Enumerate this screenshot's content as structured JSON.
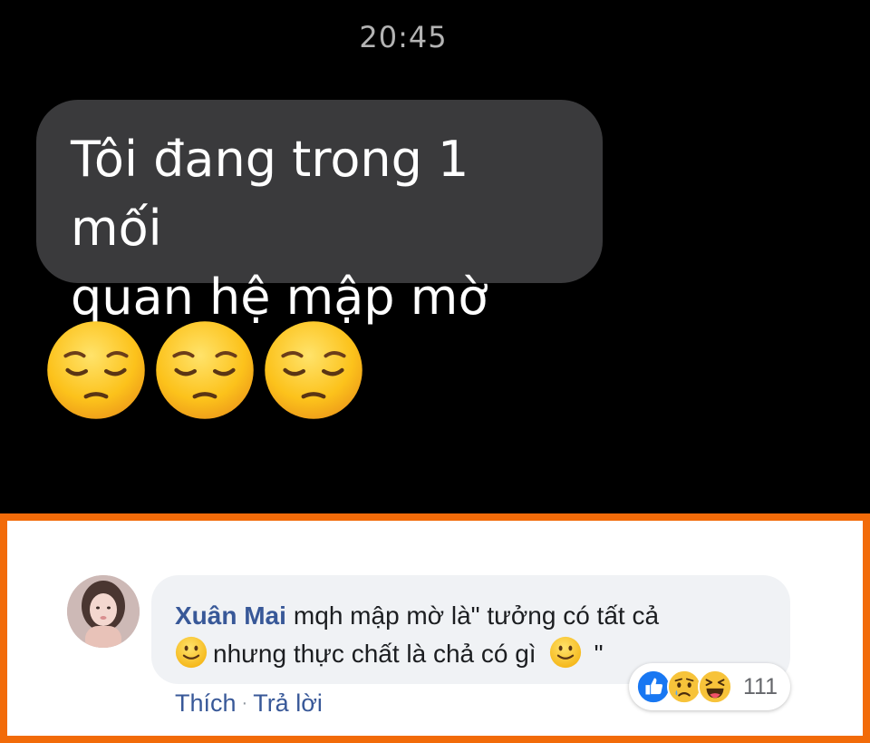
{
  "status": {
    "time": "20:45"
  },
  "message": {
    "line1": "Tôi đang trong 1 mối",
    "line2": "quan hệ mập mờ",
    "emojis": [
      "pensive-face-icon",
      "pensive-face-icon",
      "pensive-face-icon"
    ]
  },
  "comment": {
    "author": "Xuân Mai",
    "text_part1": "mqh mập mờ là\" tưởng có tất cả",
    "text_part2": "nhưng thực chất là chả có gì",
    "text_part3": "\"",
    "inline_emoji": "slightly-smiling-face-icon",
    "actions": {
      "like": "Thích",
      "separator": "·",
      "reply": "Trả lời"
    },
    "reactions": {
      "icons": [
        "like-reaction-icon",
        "sad-reaction-icon",
        "haha-reaction-icon"
      ],
      "count": "111"
    }
  },
  "colors": {
    "chat_background": "#000000",
    "bubble": "#3a3a3c",
    "highlight_border": "#f26b09",
    "author_link": "#385898",
    "comment_bubble": "#f0f2f5"
  }
}
